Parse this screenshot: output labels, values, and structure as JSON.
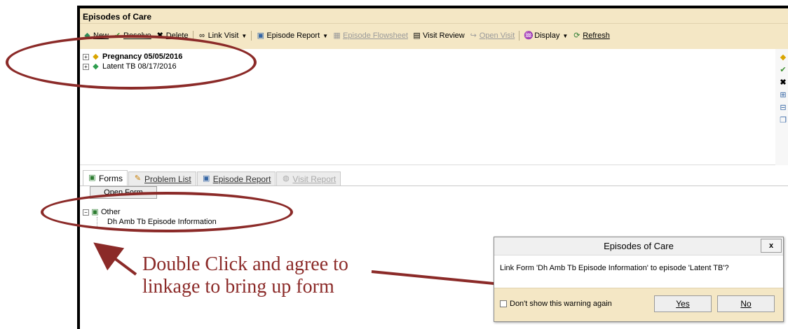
{
  "window": {
    "title": "Episodes of Care"
  },
  "toolbar": {
    "new": "New",
    "resolve": "Resolve",
    "delete": "Delete",
    "link_visit": "Link Visit",
    "episode_report": "Episode Report",
    "episode_flowsheet": "Episode Flowsheet",
    "visit_review": "Visit Review",
    "open_visit": "Open Visit",
    "display": "Display",
    "refresh": "Refresh"
  },
  "episodes": [
    {
      "label": "Pregnancy 05/05/2016",
      "bold": true
    },
    {
      "label": "Latent TB 08/17/2016",
      "bold": false
    }
  ],
  "tabs": [
    {
      "label": "Forms",
      "active": true
    },
    {
      "label": "Problem List",
      "active": false
    },
    {
      "label": "Episode Report",
      "active": false
    },
    {
      "label": "Visit Report",
      "active": false,
      "disabled": true
    }
  ],
  "forms_panel": {
    "open_form_button": "Open Form",
    "group": "Other",
    "item": "Dh Amb Tb Episode Information"
  },
  "annotation": {
    "line1": "Double Click and agree to",
    "line2": "linkage to bring up form",
    "color": "#8b2a28"
  },
  "dialog": {
    "title": "Episodes of Care",
    "close": "x",
    "message": "Link Form 'Dh Amb Tb Episode Information' to episode 'Latent TB'?",
    "checkbox_label": "Don't show this warning again",
    "yes": "Yes",
    "no": "No"
  },
  "colors": {
    "toolbar_bg": "#f4e7c5",
    "annotation": "#8b2a28"
  }
}
